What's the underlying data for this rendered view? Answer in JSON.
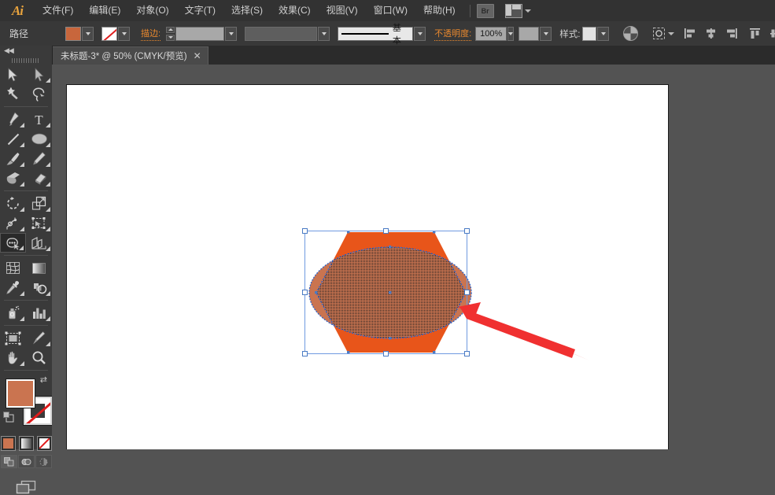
{
  "app": {
    "name": "Ai",
    "logo_color": "#e8a33d"
  },
  "menubar": {
    "items": [
      {
        "label": "文件(F)",
        "name": "menu-file"
      },
      {
        "label": "编辑(E)",
        "name": "menu-edit"
      },
      {
        "label": "对象(O)",
        "name": "menu-object"
      },
      {
        "label": "文字(T)",
        "name": "menu-type"
      },
      {
        "label": "选择(S)",
        "name": "menu-select"
      },
      {
        "label": "效果(C)",
        "name": "menu-effect"
      },
      {
        "label": "视图(V)",
        "name": "menu-view"
      },
      {
        "label": "窗口(W)",
        "name": "menu-window"
      },
      {
        "label": "帮助(H)",
        "name": "menu-help"
      }
    ],
    "bridge_label": "Br",
    "workspace_label": ""
  },
  "controlbar": {
    "object_type": "路径",
    "fill_color": "#c8663c",
    "stroke_none_label": "",
    "stroke_label": "描边:",
    "stroke_weight": "",
    "brush_label": "基本",
    "opacity_label": "不透明度:",
    "opacity_value": "100%",
    "style_label": "样式:",
    "align_icons": [
      "align-left-icon",
      "align-center-h-icon",
      "align-right-icon",
      "align-top-icon",
      "align-middle-v-icon",
      "align-bottom-icon"
    ]
  },
  "tab": {
    "title": "未标题-3* @ 50% (CMYK/预览)",
    "close": "✕"
  },
  "toolbar": {
    "collapse_icon": "◀◀",
    "tools": [
      {
        "name": "selection-tool",
        "label": "选择工具",
        "active": false
      },
      {
        "name": "direct-selection-tool",
        "label": "直接选择工具",
        "active": false
      },
      {
        "name": "magic-wand-tool",
        "label": "魔棒工具",
        "active": false
      },
      {
        "name": "lasso-tool",
        "label": "套索工具",
        "active": false
      },
      {
        "name": "pen-tool",
        "label": "钢笔工具",
        "active": false
      },
      {
        "name": "type-tool",
        "label": "文字工具",
        "active": false
      },
      {
        "name": "line-segment-tool",
        "label": "直线段工具",
        "active": false
      },
      {
        "name": "ellipse-tool",
        "label": "椭圆工具",
        "active": false
      },
      {
        "name": "paintbrush-tool",
        "label": "画笔工具",
        "active": false
      },
      {
        "name": "pencil-tool",
        "label": "铅笔工具",
        "active": false
      },
      {
        "name": "blob-brush-tool",
        "label": "斑点画笔工具",
        "active": false
      },
      {
        "name": "eraser-tool",
        "label": "橡皮擦工具",
        "active": false
      },
      {
        "name": "rotate-tool",
        "label": "旋转工具",
        "active": false
      },
      {
        "name": "scale-tool",
        "label": "比例缩放工具",
        "active": false
      },
      {
        "name": "width-tool",
        "label": "宽度工具",
        "active": false
      },
      {
        "name": "free-transform-tool",
        "label": "自由变换工具",
        "active": false
      },
      {
        "name": "shape-builder-tool",
        "label": "形状生成器工具",
        "active": true
      },
      {
        "name": "perspective-grid-tool",
        "label": "透视网格工具",
        "active": false
      },
      {
        "name": "mesh-tool",
        "label": "网格工具",
        "active": false
      },
      {
        "name": "gradient-tool",
        "label": "渐变工具",
        "active": false
      },
      {
        "name": "eyedropper-tool",
        "label": "吸管工具",
        "active": false
      },
      {
        "name": "blend-tool",
        "label": "混合工具",
        "active": false
      },
      {
        "name": "symbol-sprayer-tool",
        "label": "符号喷枪工具",
        "active": false
      },
      {
        "name": "column-graph-tool",
        "label": "柱形图工具",
        "active": false
      },
      {
        "name": "artboard-tool",
        "label": "画板工具",
        "active": false
      },
      {
        "name": "slice-tool",
        "label": "切片工具",
        "active": false
      },
      {
        "name": "hand-tool",
        "label": "抓手工具",
        "active": false
      },
      {
        "name": "zoom-tool",
        "label": "缩放工具",
        "active": false
      }
    ],
    "fill_color": "#ca7450",
    "stroke_color": "none",
    "mini_swatches": [
      "color-swatch",
      "gradient-swatch",
      "none-swatch"
    ],
    "draw_modes": [
      "draw-normal",
      "draw-behind",
      "draw-inside"
    ],
    "screen_mode": "screen-mode-icon"
  },
  "canvas": {
    "zoom": "50%",
    "artwork": {
      "hexagon_color": "#e8551a",
      "ellipse_color": "#ca7450",
      "selection_color": "#6f9ae0",
      "annotation_arrow_color": "#f03030"
    }
  }
}
